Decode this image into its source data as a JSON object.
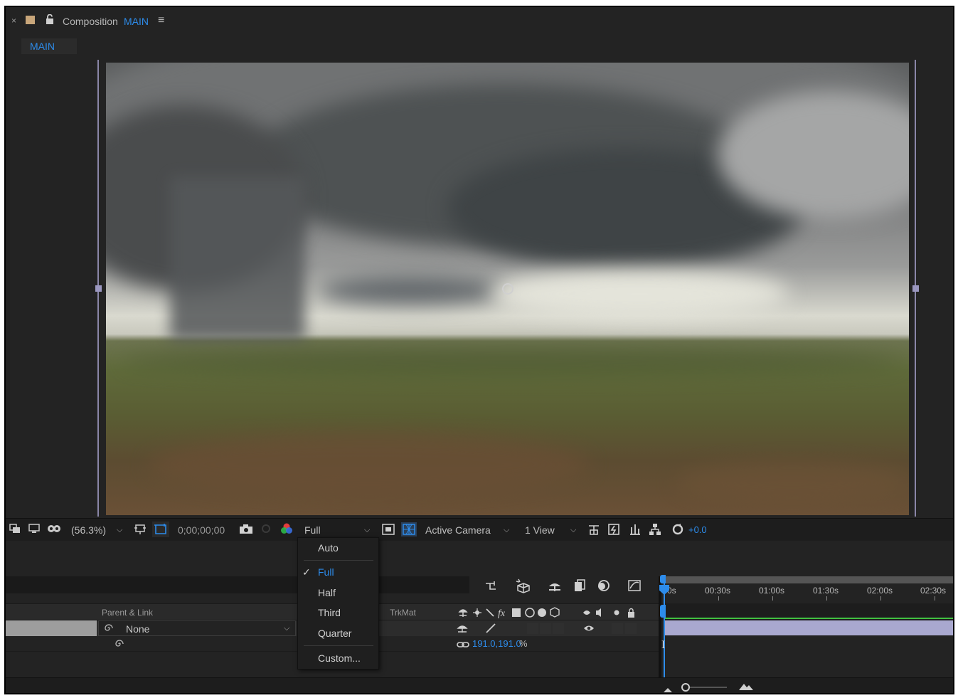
{
  "composition": {
    "close_glyph": "×",
    "panel_label": "Composition",
    "comp_name": "MAIN",
    "menu_glyph": "≡",
    "tab_label": "MAIN"
  },
  "viewer_bar": {
    "zoom": "(56.3%)",
    "timecode": "0;00;00;00",
    "resolution": "Full",
    "view_camera": "Active Camera",
    "view_layout": "1 View",
    "exposure": "+0.0"
  },
  "resolution_menu": {
    "items": [
      "Auto",
      "Full",
      "Half",
      "Third",
      "Quarter",
      "Custom..."
    ],
    "selected": "Full",
    "check_glyph": "✓"
  },
  "timeline": {
    "col_parent": "Parent & Link",
    "col_trkmat": "TrkMat",
    "parent_value": "None",
    "scale_value": "191.0,191.0",
    "scale_unit": "%",
    "ruler_ticks": [
      "0s",
      "00:30s",
      "01:00s",
      "01:30s",
      "02:00s",
      "02:30s"
    ]
  },
  "colors": {
    "accent": "#2d8ceb",
    "layer_bar": "#a9a8cf",
    "panel_bg": "#232323"
  },
  "icons": [
    "close-icon",
    "lock-icon",
    "hamburger-menu-icon",
    "snapshot-camera-icon",
    "color-channels-icon",
    "region-of-interest-icon",
    "transparency-grid-icon",
    "anchor-point-icon",
    "spiral-pickwhip-icon",
    "link-chain-icon",
    "eye-icon",
    "speaker-icon",
    "solo-icon",
    "zoom-in-mountain-icon",
    "zoom-out-mountain-icon"
  ]
}
